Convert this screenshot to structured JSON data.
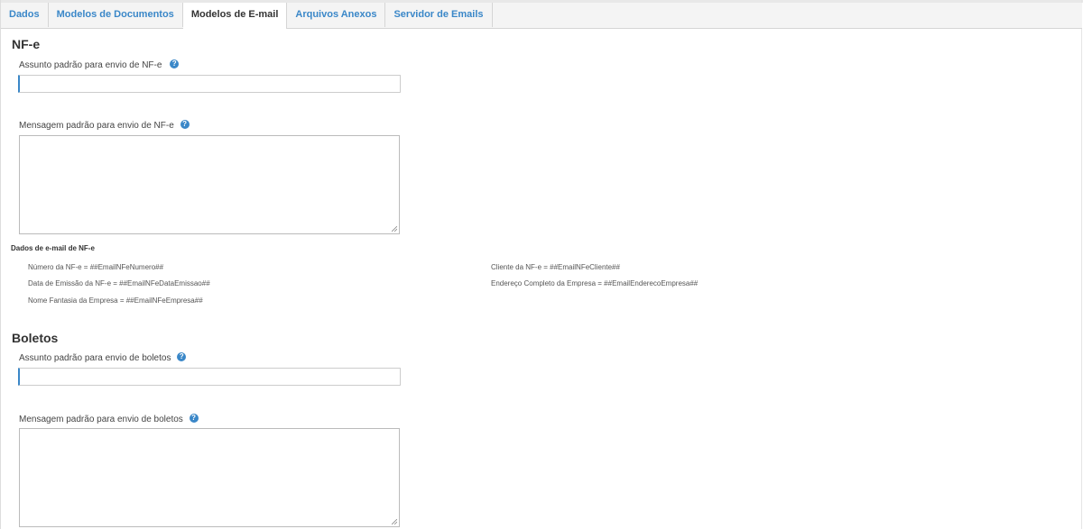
{
  "tabs": [
    {
      "label": "Dados",
      "active": false
    },
    {
      "label": "Modelos de Documentos",
      "active": false
    },
    {
      "label": "Modelos de E-mail",
      "active": true
    },
    {
      "label": "Arquivos Anexos",
      "active": false
    },
    {
      "label": "Servidor de Emails",
      "active": false
    }
  ],
  "nfe": {
    "title": "NF-e",
    "subject_label": "Assunto padrão para envio de NF-e",
    "subject_value": "",
    "message_label": "Mensagem padrão para envio de NF-e",
    "message_value": "",
    "vars_title": "Dados de e-mail de NF-e",
    "vars": {
      "numero": "Número da NF-e = ##EmailNFeNumero##",
      "data_emissao": "Data de Emissão da NF-e = ##EmailNFeDataEmissao##",
      "nome_fantasia": "Nome Fantasia da Empresa = ##EmailNFeEmpresa##",
      "cliente": "Cliente da NF-e = ##EmailNFeCliente##",
      "endereco": "Endereço Completo da Empresa = ##EmailEnderecoEmpresa##"
    }
  },
  "boletos": {
    "title": "Boletos",
    "subject_label": "Assunto padrão para envio de boletos",
    "subject_value": "",
    "message_label": "Mensagem padrão para envio de boletos",
    "message_value": ""
  },
  "icons": {
    "help": "question-circle-icon"
  },
  "colors": {
    "accent": "#3a87c8",
    "tab_bg": "#f4f4f4",
    "border": "#cccccc"
  }
}
